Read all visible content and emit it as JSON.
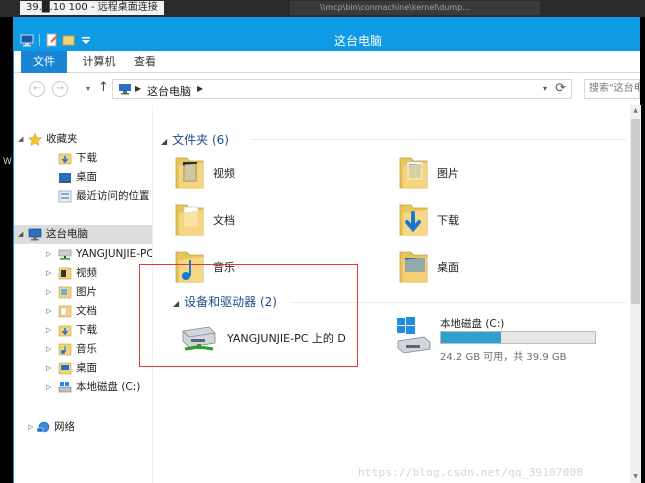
{
  "remote_desktop": {
    "title": "39.█.10  100 - 远程桌面连接",
    "right_text": "\\\\mcp\\bin\\conmachine\\kernel\\dump...",
    "left_strip_text": "W"
  },
  "window": {
    "title": "这台电脑",
    "accent": "#0e9be4"
  },
  "ribbon": {
    "tabs": [
      {
        "label": "文件"
      },
      {
        "label": "计算机"
      },
      {
        "label": "查看"
      }
    ]
  },
  "navigation": {
    "back": "←",
    "forward": "→",
    "dropdown": "▾",
    "up": "↑",
    "address_crumb": "这台电脑",
    "address_dropdown": "▾",
    "refresh": "⟳",
    "search_placeholder": "搜索\"这台电脑\""
  },
  "nav_pane": {
    "favorites": {
      "label": "收藏夹",
      "items": [
        {
          "label": "下载",
          "icon": "download-folder-icon"
        },
        {
          "label": "桌面",
          "icon": "desktop-icon"
        },
        {
          "label": "最近访问的位置",
          "icon": "recent-places-icon"
        }
      ]
    },
    "this_pc": {
      "label": "这台电脑",
      "items": [
        {
          "label": "YANGJUNJIE-PC 上的 D",
          "icon": "network-drive-icon"
        },
        {
          "label": "视频",
          "icon": "videos-folder-icon"
        },
        {
          "label": "图片",
          "icon": "pictures-folder-icon"
        },
        {
          "label": "文档",
          "icon": "documents-folder-icon"
        },
        {
          "label": "下载",
          "icon": "download-folder-icon"
        },
        {
          "label": "音乐",
          "icon": "music-folder-icon"
        },
        {
          "label": "桌面",
          "icon": "desktop-icon"
        },
        {
          "label": "本地磁盘 (C:)",
          "icon": "local-disk-icon"
        }
      ]
    },
    "network": {
      "label": "网络"
    }
  },
  "content": {
    "folders_header": "文件夹 (6)",
    "folders": [
      {
        "label": "视频",
        "icon": "videos-folder-icon"
      },
      {
        "label": "图片",
        "icon": "pictures-folder-icon"
      },
      {
        "label": "文档",
        "icon": "documents-folder-icon"
      },
      {
        "label": "下载",
        "icon": "download-folder-icon"
      },
      {
        "label": "音乐",
        "icon": "music-folder-icon"
      },
      {
        "label": "桌面",
        "icon": "desktop-folder-icon"
      }
    ],
    "devices_header": "设备和驱动器 (2)",
    "devices": [
      {
        "label": "YANGJUNJIE-PC 上的 D",
        "icon": "network-drive-icon"
      },
      {
        "label": "本地磁盘 (C:)",
        "icon": "local-disk-icon",
        "used_fraction": 0.39,
        "free_text": "24.2 GB 可用，共 39.9 GB",
        "bar_color": "#2ea0d1"
      }
    ]
  },
  "watermark": "https://blog.csdn.net/qq_39107008"
}
